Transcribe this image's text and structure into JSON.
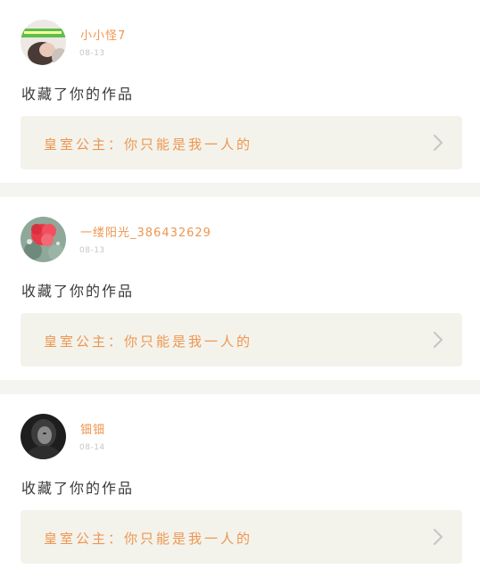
{
  "feed": [
    {
      "username": "小小怪7",
      "date": "08-13",
      "action": "收藏了你的作品",
      "work_title": "皇室公主：你只能是我一人的",
      "avatar_icon": "avatar-woman-icon"
    },
    {
      "username": "一缕阳光_386432629",
      "date": "08-13",
      "action": "收藏了你的作品",
      "work_title": "皇室公主：你只能是我一人的",
      "avatar_icon": "avatar-flower-icon"
    },
    {
      "username": "钿钿",
      "date": "08-14",
      "action": "收藏了你的作品",
      "work_title": "皇室公主：你只能是我一人的",
      "avatar_icon": "avatar-dark-portrait-icon"
    }
  ],
  "colors": {
    "accent": "#ef9650",
    "card_bg": "#f3f3ec",
    "divider": "#f4f4f1",
    "text": "#3a3a3a",
    "muted": "#c6c6c6"
  }
}
